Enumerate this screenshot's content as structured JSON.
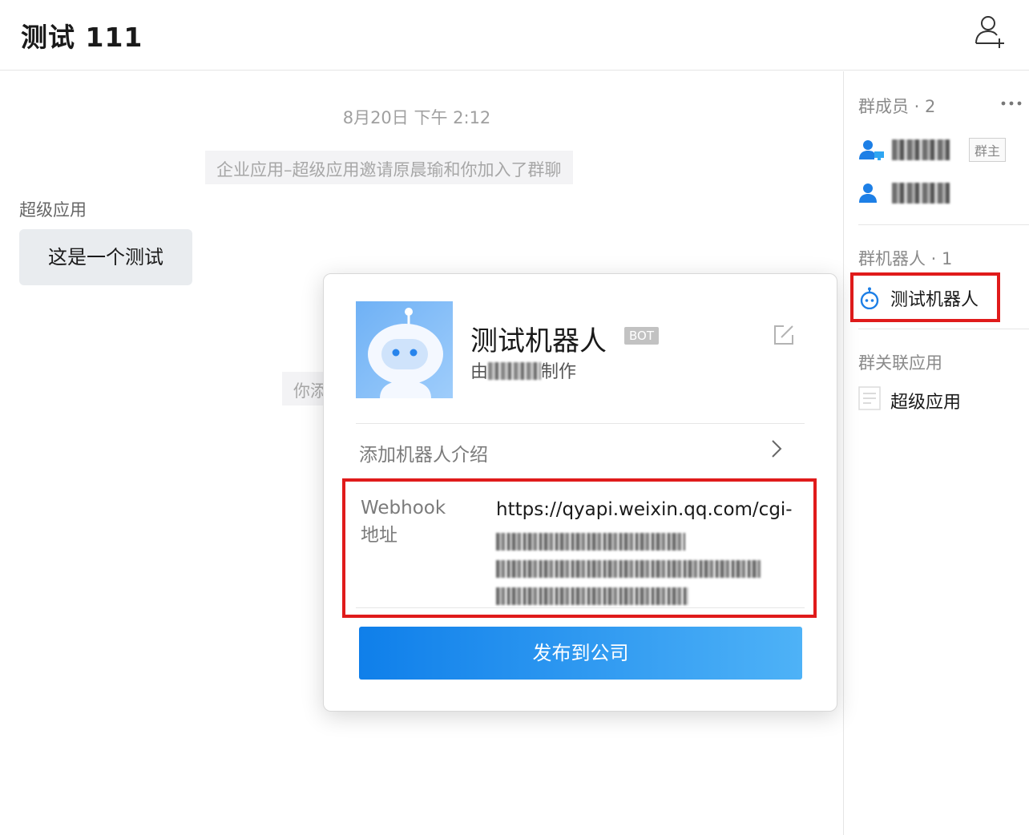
{
  "header": {
    "title": "测试 111",
    "add_member_icon": "add-person-icon"
  },
  "chat": {
    "timestamp": "8月20日 下午 2:12",
    "system_notice": "企业应用–超级应用邀请原晨瑜和你加入了群聊",
    "sender": "超级应用",
    "message": "这是一个测试",
    "system_notice_2_partial": "你添"
  },
  "panel": {
    "members_title": "群成员 · 2",
    "owner_badge": "群主",
    "bots_title": "群机器人 · 1",
    "bot_name": "测试机器人",
    "apps_title": "群关联应用",
    "app_name": "超级应用"
  },
  "popup": {
    "bot_name": "测试机器人",
    "bot_badge": "BOT",
    "creator_prefix": "由",
    "creator_suffix": "制作",
    "intro_label": "添加机器人介绍",
    "webhook_label": "Webhook 地址",
    "webhook_url_visible": "https://qyapi.weixin.qq.com/cgi-",
    "publish_button": "发布到公司"
  },
  "colors": {
    "highlight": "#e01b1b",
    "accent": "#0f7fea",
    "bubble_bg": "#e9ecef"
  }
}
